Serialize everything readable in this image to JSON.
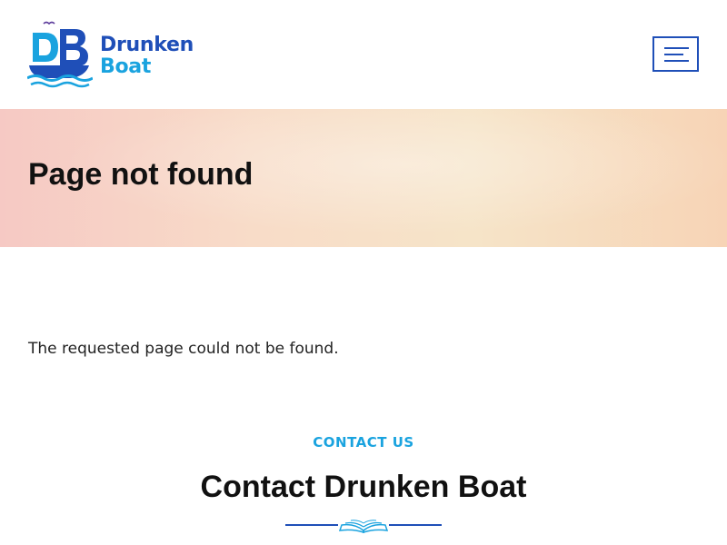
{
  "header": {
    "logo": {
      "line1": "Drunken",
      "line2": "Boat",
      "brand_color": "#1f4fb8",
      "accent_color": "#1aa3df"
    },
    "menu_icon": "hamburger-icon"
  },
  "hero": {
    "title": "Page not found"
  },
  "main": {
    "message": "The requested page could not be found."
  },
  "contact": {
    "eyebrow": "CONTACT US",
    "title": "Contact Drunken Boat",
    "divider_icon": "open-book-icon"
  }
}
